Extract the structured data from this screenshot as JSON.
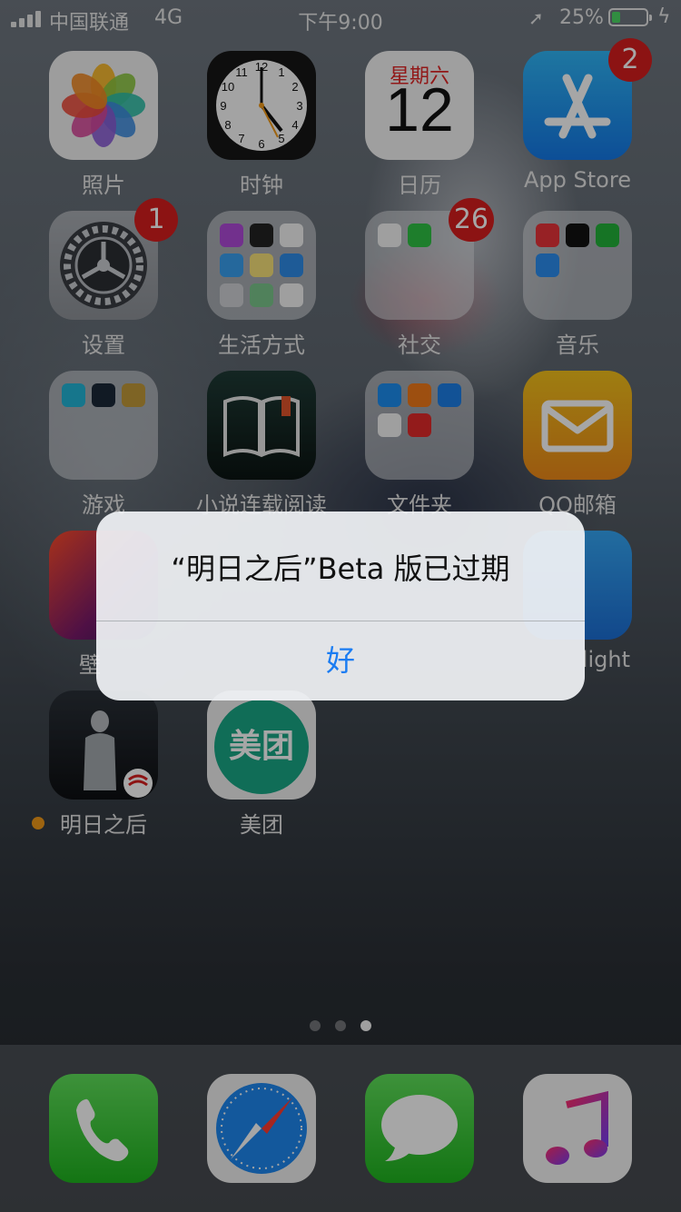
{
  "status": {
    "carrier": "中国联通",
    "network": "4G",
    "time": "下午9:00",
    "battery_pct": "25%",
    "battery_level": 0.25,
    "colors": {
      "battery": "#4cd964"
    }
  },
  "apps": {
    "photos": "照片",
    "clock": "时钟",
    "calendar": {
      "label": "日历",
      "weekday": "星期六",
      "day": "12"
    },
    "appstore": {
      "label": "App Store",
      "badge": "2"
    },
    "settings": {
      "label": "设置",
      "badge": "1"
    },
    "lifestyle": "生活方式",
    "social": {
      "label": "社交",
      "badge": "26"
    },
    "music_folder": "音乐",
    "games": "游戏",
    "reader": "小说连载阅读",
    "files": "文件夹",
    "qqmail": "QQ邮箱",
    "wallpaper": "壁",
    "nightlight": "light",
    "mingri": "明日之后",
    "meituan": {
      "label": "美团",
      "glyph": "美团"
    }
  },
  "page_dots": {
    "count": 3,
    "active": 3
  },
  "alert": {
    "title": "“明日之后”Beta 版已过期",
    "ok_label": "好"
  },
  "icons": [
    "signal-icon",
    "location-arrow-icon",
    "battery-icon",
    "charging-bolt-icon",
    "phone-icon",
    "safari-compass-icon",
    "messages-bubble-icon",
    "music-note-icon"
  ]
}
